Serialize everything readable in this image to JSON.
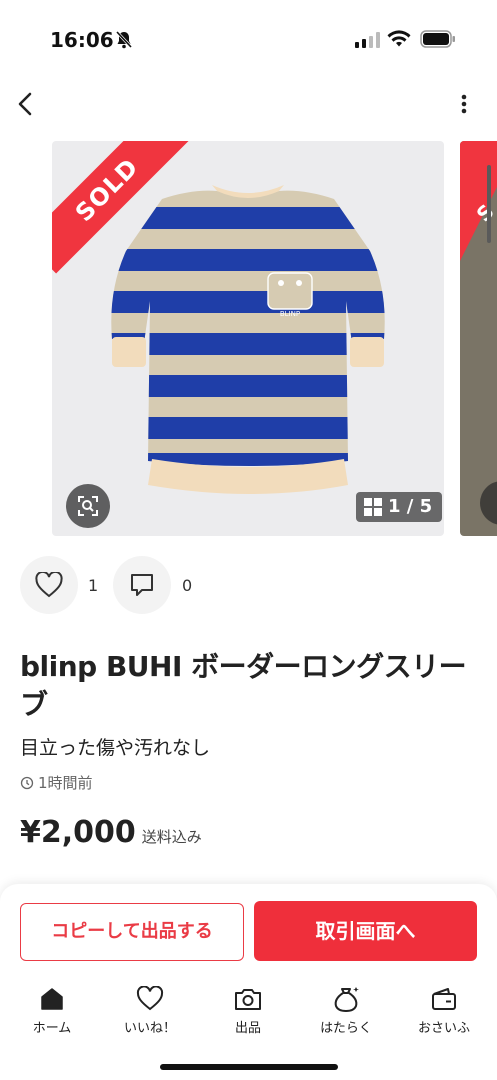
{
  "status_bar": {
    "time": "16:06"
  },
  "carousel": {
    "sold_label": "SOLD",
    "counter": "1 / 5",
    "image_colors": {
      "navy": "#1f3ea8",
      "beige": "#d8ccb4"
    }
  },
  "engagement": {
    "likes": "1",
    "comments": "0"
  },
  "item": {
    "title": "blinp BUHI ボーダーロングスリーブ",
    "condition": "目立った傷や汚れなし",
    "posted": "1時間前",
    "price": "¥2,000",
    "price_note": "送料込み"
  },
  "actions": {
    "copy_label": "コピーして出品する",
    "trade_label": "取引画面へ"
  },
  "tabs": [
    {
      "label": "ホーム",
      "icon": "home-icon"
    },
    {
      "label": "いいね！",
      "icon": "heart-icon"
    },
    {
      "label": "出品",
      "icon": "camera-icon"
    },
    {
      "label": "はたらく",
      "icon": "bag-icon"
    },
    {
      "label": "おさいふ",
      "icon": "wallet-icon"
    }
  ],
  "colors": {
    "accent": "#ef2f3b"
  }
}
